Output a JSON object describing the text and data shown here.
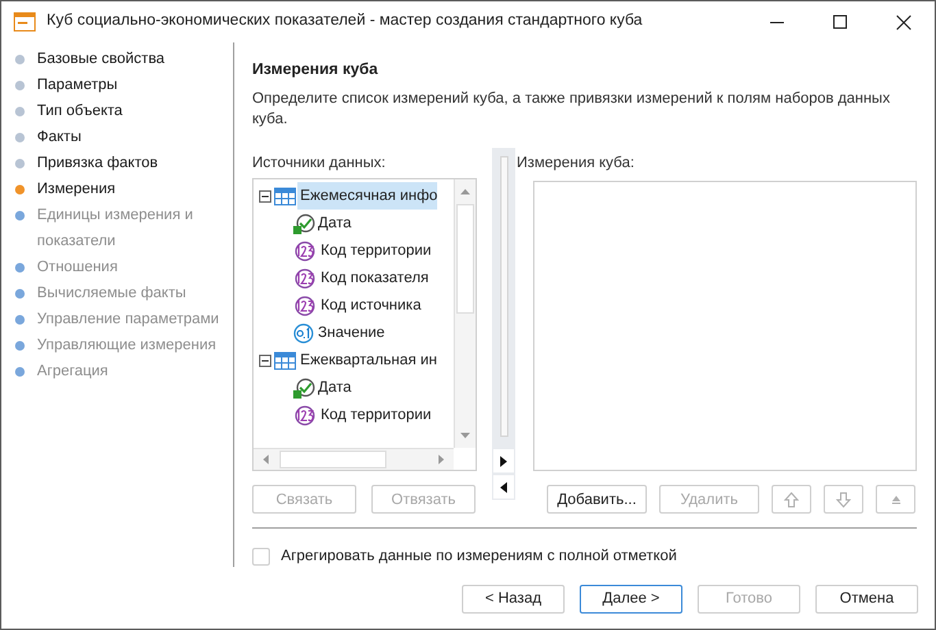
{
  "window": {
    "title": "Куб социально-экономических показателей - мастер создания стандартного куба"
  },
  "steps": [
    {
      "label": "Базовые свойства",
      "selected": false,
      "disabled": false
    },
    {
      "label": "Параметры",
      "selected": false,
      "disabled": false
    },
    {
      "label": "Тип объекта",
      "selected": false,
      "disabled": false
    },
    {
      "label": "Факты",
      "selected": false,
      "disabled": false
    },
    {
      "label": "Привязка фактов",
      "selected": false,
      "disabled": false
    },
    {
      "label": "Измерения",
      "selected": true,
      "disabled": false
    },
    {
      "label": "Единицы измерения и показатели",
      "selected": false,
      "disabled": true
    },
    {
      "label": "Отношения",
      "selected": false,
      "disabled": true
    },
    {
      "label": "Вычисляемые факты",
      "selected": false,
      "disabled": true
    },
    {
      "label": "Управление параметрами",
      "selected": false,
      "disabled": true
    },
    {
      "label": "Управляющие измерения",
      "selected": false,
      "disabled": true
    },
    {
      "label": "Агрегация",
      "selected": false,
      "disabled": true
    }
  ],
  "heading": "Измерения куба",
  "description": "Определите список измерений куба, а также привязки измерений к полям наборов данных куба.",
  "sources": {
    "label": "Источники данных:",
    "tree": [
      {
        "label": "Ежемесячная инфо",
        "expanded": true,
        "selected": true,
        "children": [
          {
            "label": "Дата",
            "kind": "date"
          },
          {
            "label": "Код территории",
            "kind": "integer"
          },
          {
            "label": "Код показателя",
            "kind": "integer"
          },
          {
            "label": "Код источника",
            "kind": "integer"
          },
          {
            "label": "Значение",
            "kind": "float"
          }
        ]
      },
      {
        "label": "Ежеквартальная ин",
        "expanded": true,
        "selected": false,
        "children": [
          {
            "label": "Дата",
            "kind": "date"
          },
          {
            "label": "Код территории",
            "kind": "integer"
          }
        ]
      }
    ],
    "buttons": [
      {
        "label": "Связать",
        "disabled": true
      },
      {
        "label": "Отвязать",
        "disabled": true
      }
    ]
  },
  "dimensions": {
    "label": "Измерения куба:",
    "buttons": [
      {
        "label": "Добавить...",
        "kind": "text",
        "disabled": false
      },
      {
        "label": "Удалить",
        "kind": "text",
        "disabled": true
      },
      {
        "kind": "up",
        "disabled": true
      },
      {
        "kind": "down",
        "disabled": true
      },
      {
        "kind": "top",
        "disabled": true
      }
    ]
  },
  "aggregate": {
    "label": "Агрегировать данные по измерениям с полной отметкой",
    "checked": false
  },
  "footer": [
    {
      "label": "< Назад",
      "default": false,
      "disabled": false
    },
    {
      "label": "Далее >",
      "default": true,
      "disabled": false
    },
    {
      "label": "Готово",
      "default": false,
      "disabled": true
    },
    {
      "label": "Отмена",
      "default": false,
      "disabled": false
    }
  ]
}
